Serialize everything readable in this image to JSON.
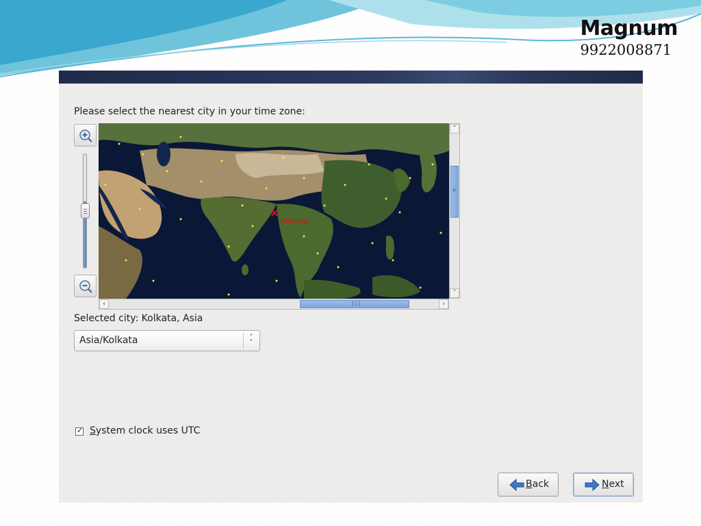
{
  "slide": {
    "brand_name": "Magnum",
    "brand_phone": "9922008871"
  },
  "installer": {
    "prompt": "Please select the nearest city in your time zone:",
    "map": {
      "selected_marker_label": "Kolkata",
      "zoom_in_icon": "zoom-in-icon",
      "zoom_out_icon": "zoom-out-icon"
    },
    "selected_city_text": "Selected city: Kolkata, Asia",
    "timezone_select": {
      "value": "Asia/Kolkata"
    },
    "utc_checkbox": {
      "checked": true,
      "label_mnemonic": "S",
      "label_rest": "ystem clock uses UTC"
    },
    "buttons": {
      "back": {
        "mnemonic": "B",
        "rest": "ack"
      },
      "next": {
        "mnemonic": "N",
        "rest": "ext"
      }
    }
  },
  "colors": {
    "window_bg": "#edeceb",
    "titlebar": "#1f2b4a",
    "marker": "#e01010",
    "city_dot": "#f5e83a",
    "scroll_thumb": "#8fb2e2"
  }
}
